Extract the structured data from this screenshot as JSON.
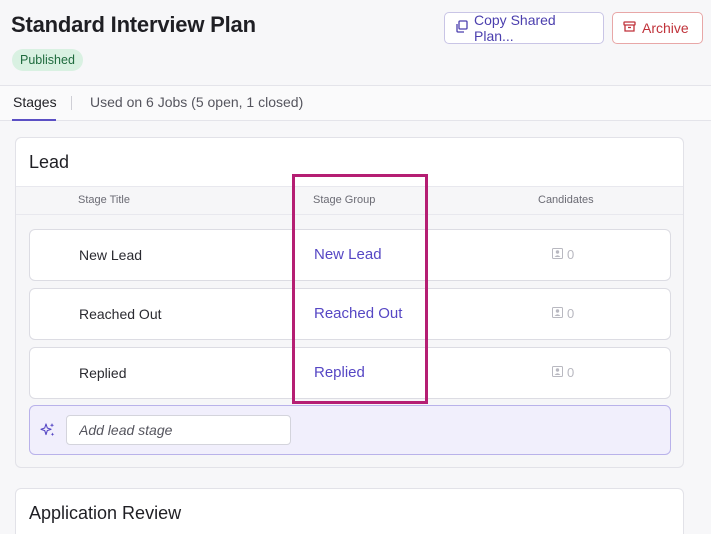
{
  "header": {
    "title": "Standard Interview Plan",
    "status": "Published",
    "copy_button": "Copy Shared Plan...",
    "archive_button": "Archive"
  },
  "tabs": {
    "stages": "Stages",
    "jobs_info": "Used on 6 Jobs (5 open, 1 closed)"
  },
  "lead_section": {
    "title": "Lead",
    "columns": {
      "stage_title": "Stage Title",
      "stage_group": "Stage Group",
      "candidates": "Candidates"
    },
    "rows": [
      {
        "title": "New Lead",
        "group": "New Lead",
        "candidates": "0"
      },
      {
        "title": "Reached Out",
        "group": "Reached Out",
        "candidates": "0"
      },
      {
        "title": "Replied",
        "group": "Replied",
        "candidates": "0"
      }
    ],
    "add_placeholder": "Add lead stage"
  },
  "application_section": {
    "title": "Application Review"
  },
  "colors": {
    "accent": "#5647c4",
    "highlight": "#b51e73",
    "archive": "#c0323a",
    "published_bg": "#d9f1e2"
  },
  "icons": {
    "copy": "copy-icon",
    "archive": "archive-icon",
    "candidate": "person-icon",
    "sparkle": "sparkle-icon"
  }
}
